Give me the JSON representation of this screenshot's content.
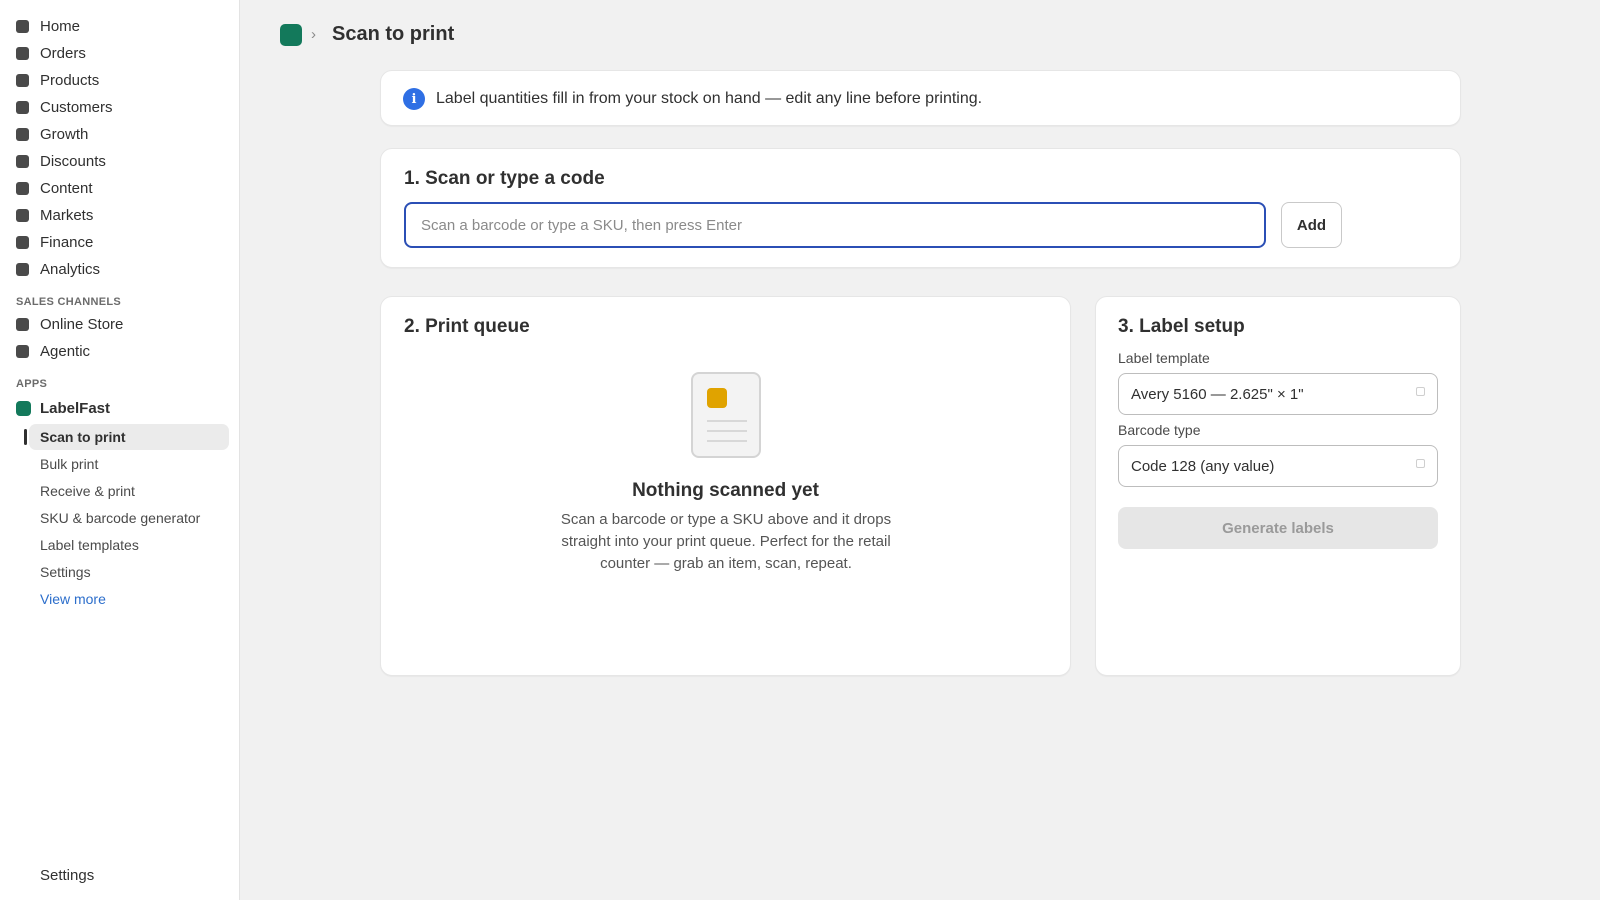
{
  "sidebar": {
    "main_items": [
      {
        "label": "Home"
      },
      {
        "label": "Orders"
      },
      {
        "label": "Products"
      },
      {
        "label": "Customers"
      },
      {
        "label": "Growth"
      },
      {
        "label": "Discounts"
      },
      {
        "label": "Content"
      },
      {
        "label": "Markets"
      },
      {
        "label": "Finance"
      },
      {
        "label": "Analytics"
      }
    ],
    "sales_channels_label": "SALES CHANNELS",
    "channels": [
      {
        "label": "Online Store"
      },
      {
        "label": "Agentic"
      }
    ],
    "apps_label": "APPS",
    "app_name": "LabelFast",
    "app_items": [
      {
        "label": "Scan to print"
      },
      {
        "label": "Bulk print"
      },
      {
        "label": "Receive & print"
      },
      {
        "label": "SKU & barcode generator"
      },
      {
        "label": "Label templates"
      },
      {
        "label": "Settings"
      },
      {
        "label": "View more"
      }
    ],
    "bottom_settings": "Settings"
  },
  "header": {
    "chevron": "›",
    "title": "Scan to print"
  },
  "banner": {
    "icon": "info-icon",
    "text": "Label quantities fill in from your stock on hand — edit any line before printing."
  },
  "scan": {
    "title": "1. Scan or type a code",
    "placeholder": "Scan a barcode or type a SKU, then press Enter",
    "add_label": "Add"
  },
  "queue": {
    "title": "2. Print queue",
    "empty_title": "Nothing scanned yet",
    "empty_desc": "Scan a barcode or type a SKU above and it drops straight into your print queue. Perfect for the retail counter — grab an item, scan, repeat."
  },
  "setup": {
    "title": "3. Label setup",
    "template_label": "Label template",
    "template_value": "Avery 5160 — 2.625\" × 1\"",
    "barcode_label": "Barcode type",
    "barcode_value": "Code 128 (any value)",
    "generate_label": "Generate labels"
  },
  "colors": {
    "brand": "#13795b",
    "info": "#2f6fe4",
    "focus": "#2b4fb5"
  }
}
